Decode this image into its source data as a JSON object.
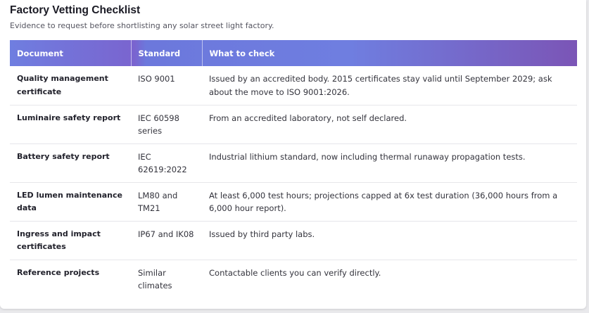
{
  "title": "Factory Vetting Checklist",
  "subtitle": "Evidence to request before shortlisting any solar street light factory.",
  "columns": [
    "Document",
    "Standard",
    "What to check"
  ],
  "rows": [
    {
      "document": "Quality management certificate",
      "standard": "ISO 9001",
      "check": "Issued by an accredited body. 2015 certificates stay valid until September 2029; ask about the move to ISO 9001:2026."
    },
    {
      "document": "Luminaire safety report",
      "standard": "IEC 60598 series",
      "check": "From an accredited laboratory, not self declared."
    },
    {
      "document": "Battery safety report",
      "standard": "IEC 62619:2022",
      "check": "Industrial lithium standard, now including thermal runaway propagation tests."
    },
    {
      "document": "LED lumen maintenance data",
      "standard": "LM80 and TM21",
      "check": "At least 6,000 test hours; projections capped at 6x test duration (36,000 hours from a 6,000 hour report)."
    },
    {
      "document": "Ingress and impact certificates",
      "standard": "IP67 and IK08",
      "check": "Issued by third party labs."
    },
    {
      "document": "Reference projects",
      "standard": "Similar climates",
      "check": "Contactable clients you can verify directly."
    }
  ],
  "colors": {
    "header_start": "#6f7ee0",
    "header_end": "#7b55b6"
  }
}
